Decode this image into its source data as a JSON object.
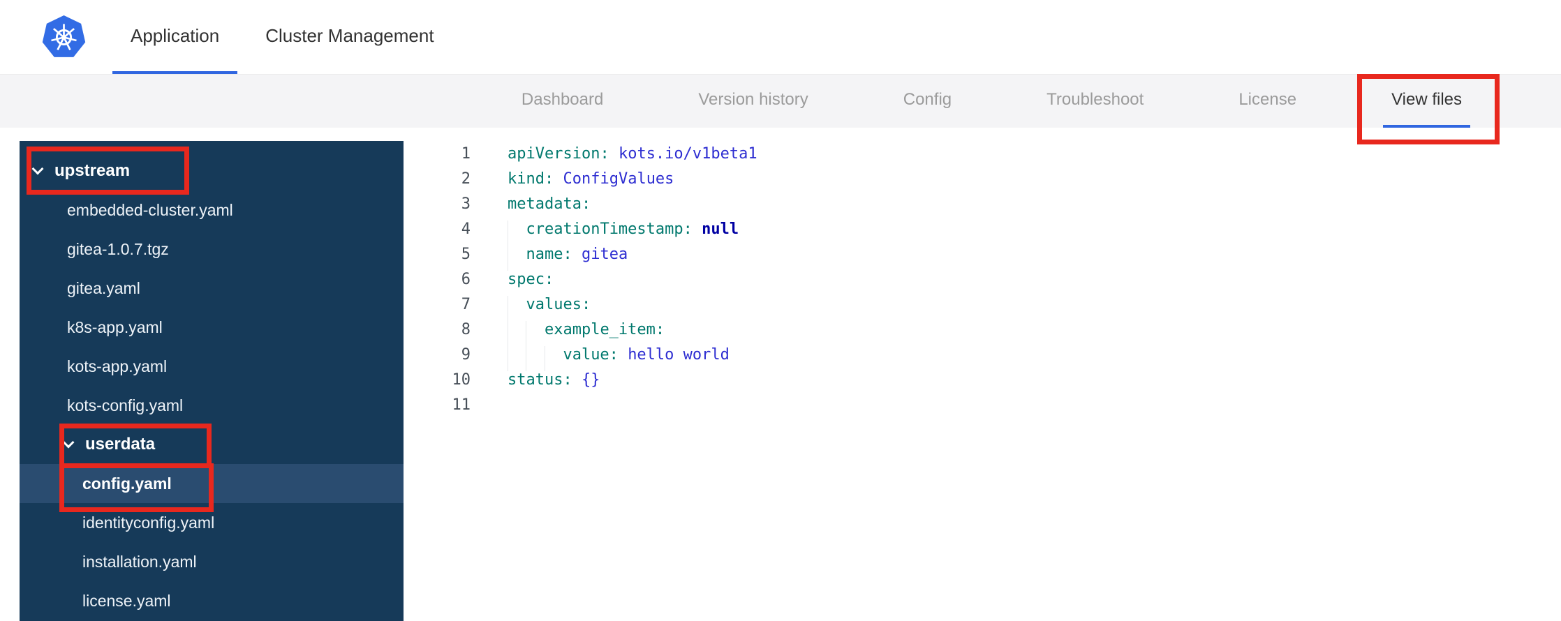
{
  "colors": {
    "accent_blue": "#3066e0",
    "annotation_red": "#e8281e",
    "sidebar_bg": "#163a59",
    "sidebar_selected_bg": "#2a4c70",
    "subnav_bg": "#f4f4f6",
    "code_key": "#00786d",
    "code_value": "#2d2dd1",
    "code_constant": "#0000a3"
  },
  "header": {
    "logo": "kubernetes-logo",
    "tabs": [
      {
        "label": "Application",
        "active": true
      },
      {
        "label": "Cluster Management",
        "active": false
      }
    ]
  },
  "subnav": {
    "tabs": [
      {
        "label": "Dashboard",
        "active": false
      },
      {
        "label": "Version history",
        "active": false
      },
      {
        "label": "Config",
        "active": false
      },
      {
        "label": "Troubleshoot",
        "active": false
      },
      {
        "label": "License",
        "active": false
      },
      {
        "label": "View files",
        "active": true
      }
    ]
  },
  "file_tree": {
    "rows": [
      {
        "type": "folder",
        "label": "upstream",
        "depth": 0,
        "expanded": true
      },
      {
        "type": "file",
        "label": "embedded-cluster.yaml",
        "depth": 1
      },
      {
        "type": "file",
        "label": "gitea-1.0.7.tgz",
        "depth": 1
      },
      {
        "type": "file",
        "label": "gitea.yaml",
        "depth": 1
      },
      {
        "type": "file",
        "label": "k8s-app.yaml",
        "depth": 1
      },
      {
        "type": "file",
        "label": "kots-app.yaml",
        "depth": 1
      },
      {
        "type": "file",
        "label": "kots-config.yaml",
        "depth": 1
      },
      {
        "type": "folder",
        "label": "userdata",
        "depth": 1,
        "expanded": true
      },
      {
        "type": "file",
        "label": "config.yaml",
        "depth": 2,
        "selected": true
      },
      {
        "type": "file",
        "label": "identityconfig.yaml",
        "depth": 2
      },
      {
        "type": "file",
        "label": "installation.yaml",
        "depth": 2
      },
      {
        "type": "file",
        "label": "license.yaml",
        "depth": 2
      }
    ]
  },
  "editor": {
    "lines": [
      [
        {
          "t": "apiVersion:",
          "c": "key"
        },
        {
          "t": " "
        },
        {
          "t": "kots.io/v1beta1",
          "c": "val"
        }
      ],
      [
        {
          "t": "kind:",
          "c": "key"
        },
        {
          "t": " "
        },
        {
          "t": "ConfigValues",
          "c": "val"
        }
      ],
      [
        {
          "t": "metadata:",
          "c": "key"
        }
      ],
      [
        {
          "t": "  ",
          "c": "ind"
        },
        {
          "t": "creationTimestamp:",
          "c": "key"
        },
        {
          "t": " "
        },
        {
          "t": "null",
          "c": "const"
        }
      ],
      [
        {
          "t": "  ",
          "c": "ind"
        },
        {
          "t": "name:",
          "c": "key"
        },
        {
          "t": " "
        },
        {
          "t": "gitea",
          "c": "val"
        }
      ],
      [
        {
          "t": "spec:",
          "c": "key"
        }
      ],
      [
        {
          "t": "  ",
          "c": "ind"
        },
        {
          "t": "values:",
          "c": "key"
        }
      ],
      [
        {
          "t": "  ",
          "c": "ind"
        },
        {
          "t": "  ",
          "c": "ind"
        },
        {
          "t": "example_item:",
          "c": "key"
        }
      ],
      [
        {
          "t": "  ",
          "c": "ind"
        },
        {
          "t": "  ",
          "c": "ind"
        },
        {
          "t": "  ",
          "c": "ind"
        },
        {
          "t": "value:",
          "c": "key"
        },
        {
          "t": " "
        },
        {
          "t": "hello world",
          "c": "val"
        }
      ],
      [
        {
          "t": "status:",
          "c": "key"
        },
        {
          "t": " "
        },
        {
          "t": "{}",
          "c": "val"
        }
      ],
      []
    ]
  },
  "annotations": [
    {
      "target": "view-files-tab"
    },
    {
      "target": "upstream-folder"
    },
    {
      "target": "userdata-folder"
    },
    {
      "target": "config-yaml-file"
    }
  ]
}
